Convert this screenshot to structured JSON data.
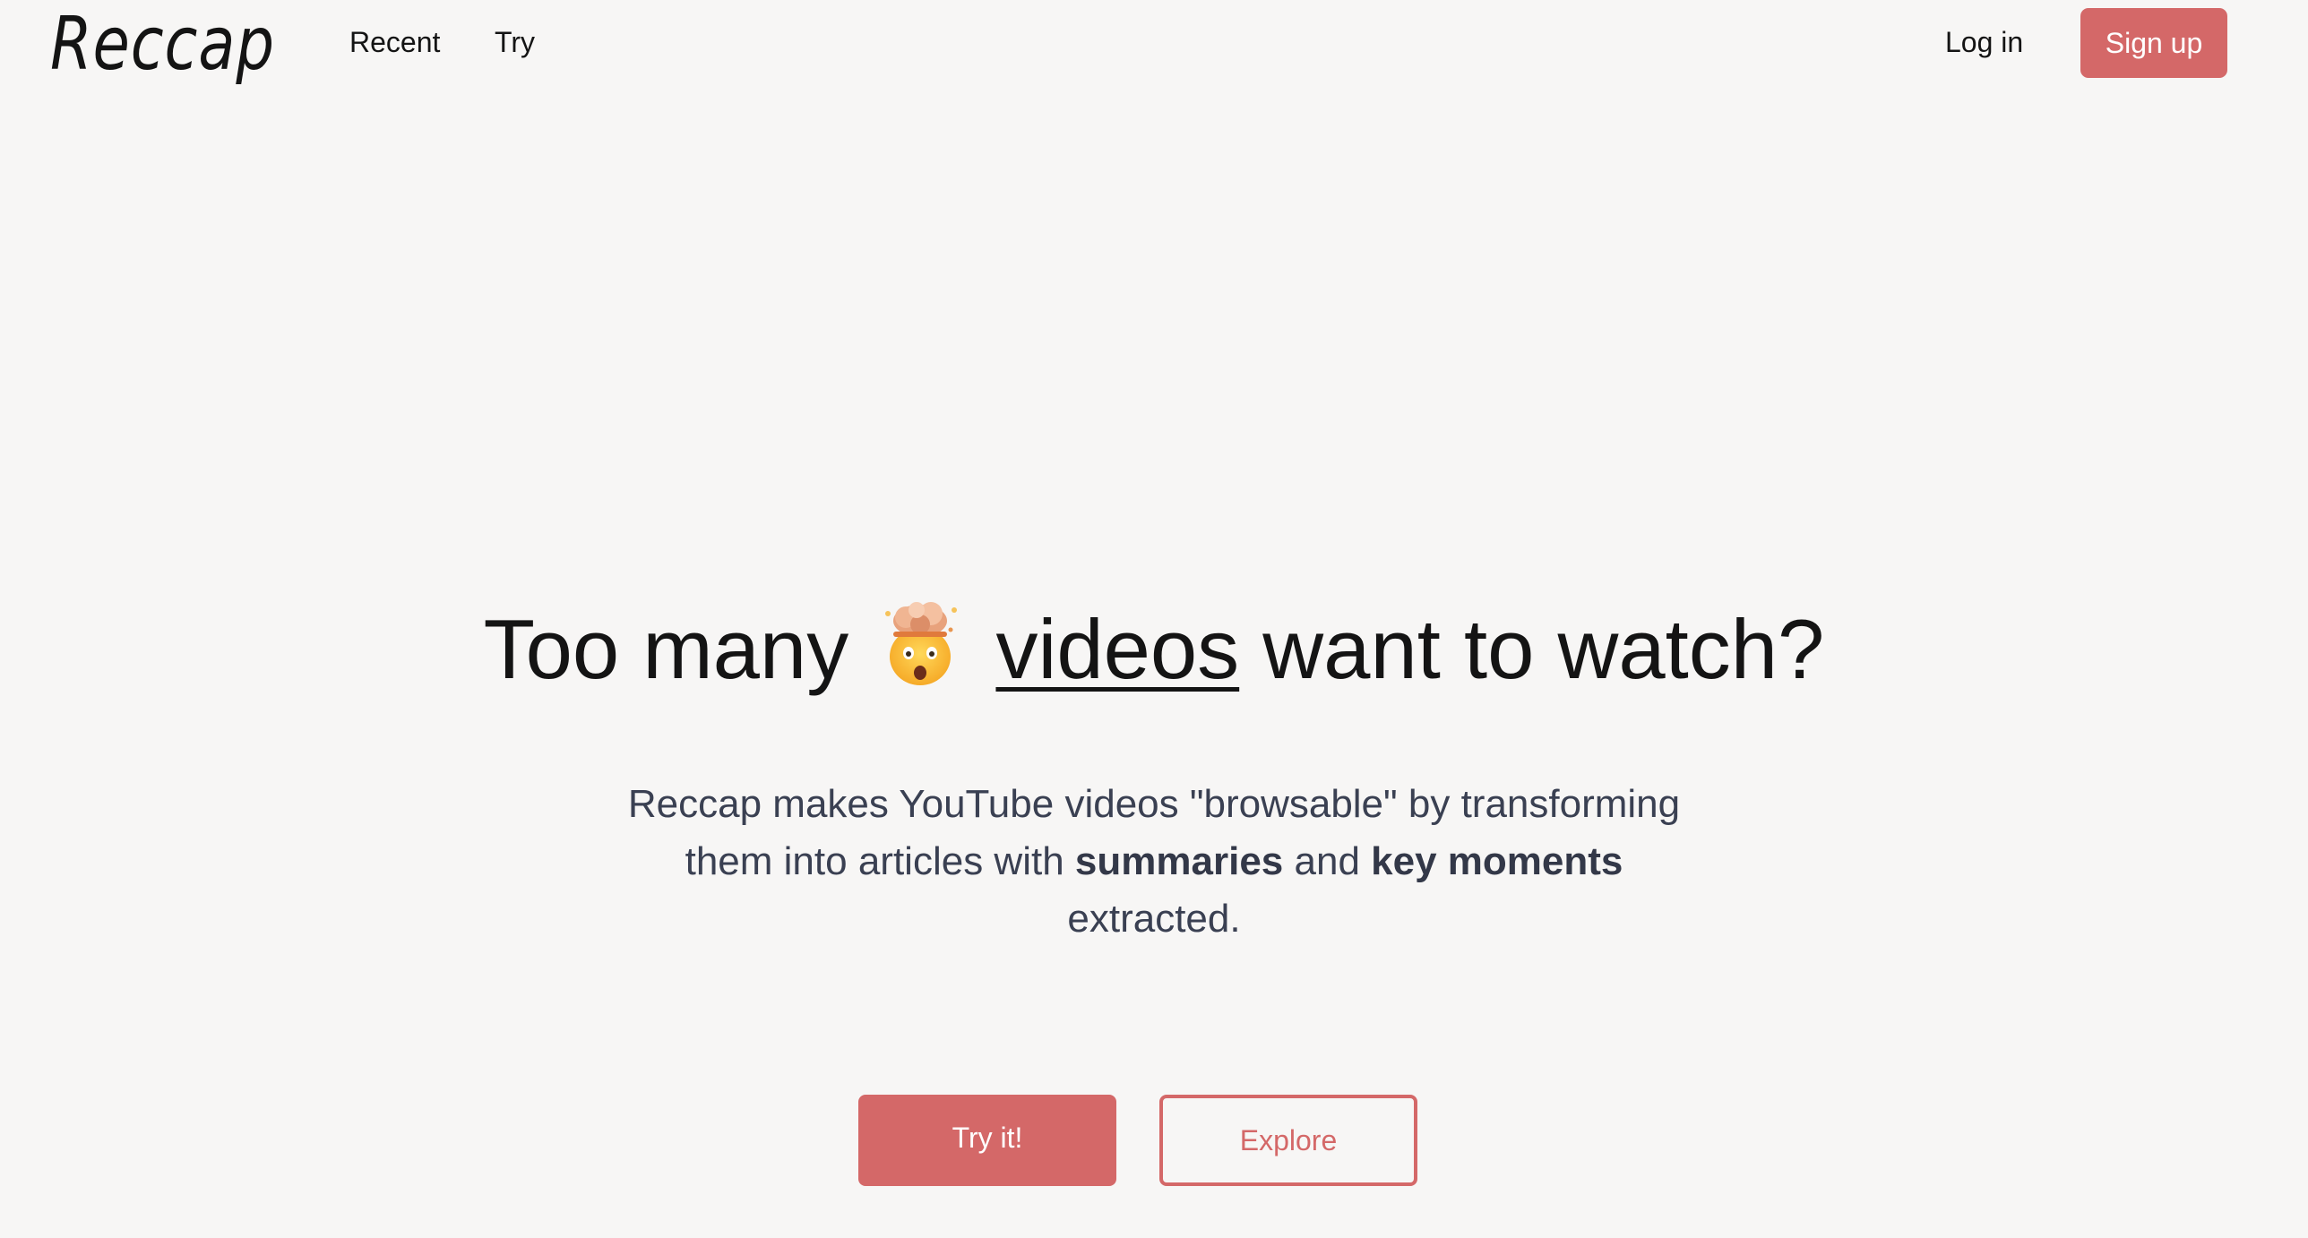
{
  "header": {
    "logo_text": "Reccap",
    "nav": {
      "recent_label": "Recent",
      "try_label": "Try"
    },
    "login_label": "Log in",
    "signup_label": "Sign up"
  },
  "hero": {
    "headline_before": "Too many",
    "headline_emoji": "exploding-head-emoji",
    "headline_link": "videos",
    "headline_after": "want to watch?",
    "subtitle_part1": "Reccap makes YouTube videos \"browsable\" by transforming them into articles with",
    "subtitle_bold1": "summaries",
    "subtitle_part2": "and",
    "subtitle_bold2": "key moments",
    "subtitle_part3": "extracted.",
    "try_button_label": "Try it!",
    "explore_button_label": "Explore"
  },
  "colors": {
    "accent": "#d46868",
    "background": "#f7f6f5",
    "text": "#141414",
    "subtitle_text": "#3a4052"
  }
}
